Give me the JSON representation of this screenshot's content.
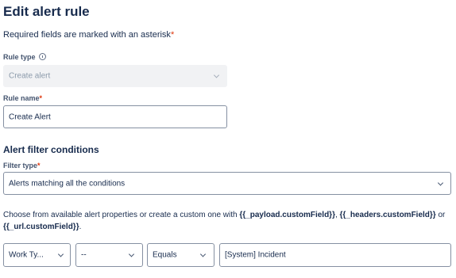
{
  "page": {
    "title": "Edit alert rule",
    "required_hint": "Required fields are marked with an asterisk",
    "required_marker": "*"
  },
  "rule_type": {
    "label": "Rule type",
    "value": "Create alert",
    "disabled": true
  },
  "rule_name": {
    "label": "Rule name",
    "value": "Create Alert"
  },
  "filter": {
    "section_title": "Alert filter conditions",
    "type_label": "Filter type",
    "type_value": "Alerts matching all the conditions"
  },
  "description": {
    "prefix": "Choose from available alert properties or create a custom one with ",
    "token_payload": "{{_payload.customField}}",
    "sep1": ", ",
    "token_headers": "{{_headers.customField}}",
    "sep2": " or ",
    "token_url": "{{_url.customField}}",
    "suffix": "."
  },
  "condition": {
    "field": "Work Ty...",
    "modifier": "--",
    "operator": "Equals",
    "value": "[System] Incident"
  },
  "colors": {
    "text": "#172b4d",
    "required": "#de350b",
    "border": "#8590a2",
    "disabled_bg": "#f1f2f4"
  }
}
